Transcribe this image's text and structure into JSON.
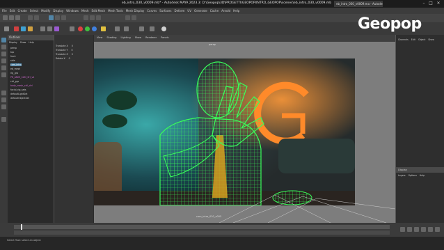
{
  "window": {
    "title": "eb_intro_030_v0009.mb* - Autodesk MAYA 2023.3: D:\\Geopop\\3D\\PROGETTI\\GEOPOP\\INTRO_GEOPOP\\scenes\\eb_intro_030_v0009.mb",
    "second_tab": "eb_intro_030_v0009.ma - Autodesk"
  },
  "brand": {
    "logo": "Geopop"
  },
  "menubar": {
    "items": [
      "File",
      "Edit",
      "Create",
      "Select",
      "Modify",
      "Display",
      "Windows",
      "Mesh",
      "Edit Mesh",
      "Mesh Tools",
      "Mesh Display",
      "Curves",
      "Surfaces",
      "Deform",
      "UV",
      "Generate",
      "Cache",
      "Arnold",
      "Help"
    ]
  },
  "outliner": {
    "title": "Outliner",
    "menus": [
      "Display",
      "Show",
      "Help"
    ],
    "items": [
      "persp",
      "top",
      "front",
      "side",
      "cam_intro",
      "eb_mesh",
      "rig_grp",
      "PR_ANIM_CAM_SH_v4",
      "crtl_grp",
      "body_mesh_crtl_ctrl",
      "facial_rig_sets",
      "defaultLightSet",
      "defaultObjectSet"
    ]
  },
  "channels": {
    "rows": [
      {
        "label": "Translate X",
        "value": "0"
      },
      {
        "label": "Translate Y",
        "value": "0"
      },
      {
        "label": "Translate Z",
        "value": "0"
      },
      {
        "label": "Rotate X",
        "value": "0"
      }
    ]
  },
  "viewport": {
    "panel_label": "persp",
    "camera_label": "cam_intro_030_v005",
    "menus": [
      "View",
      "Shading",
      "Lighting",
      "Show",
      "Renderer",
      "Panels"
    ]
  },
  "right_panel": {
    "tabs": [
      "Channels",
      "Edit",
      "Object",
      "Show"
    ],
    "layers_title": "Display",
    "layer_tabs": [
      "Layers",
      "Options",
      "Help"
    ]
  },
  "statusbar": {
    "text": "Select Tool: select an object"
  },
  "colors": {
    "wireframe": "#39ff5a",
    "maya_accent": "#5285a6",
    "logo_orange": "#ff8a2a"
  }
}
